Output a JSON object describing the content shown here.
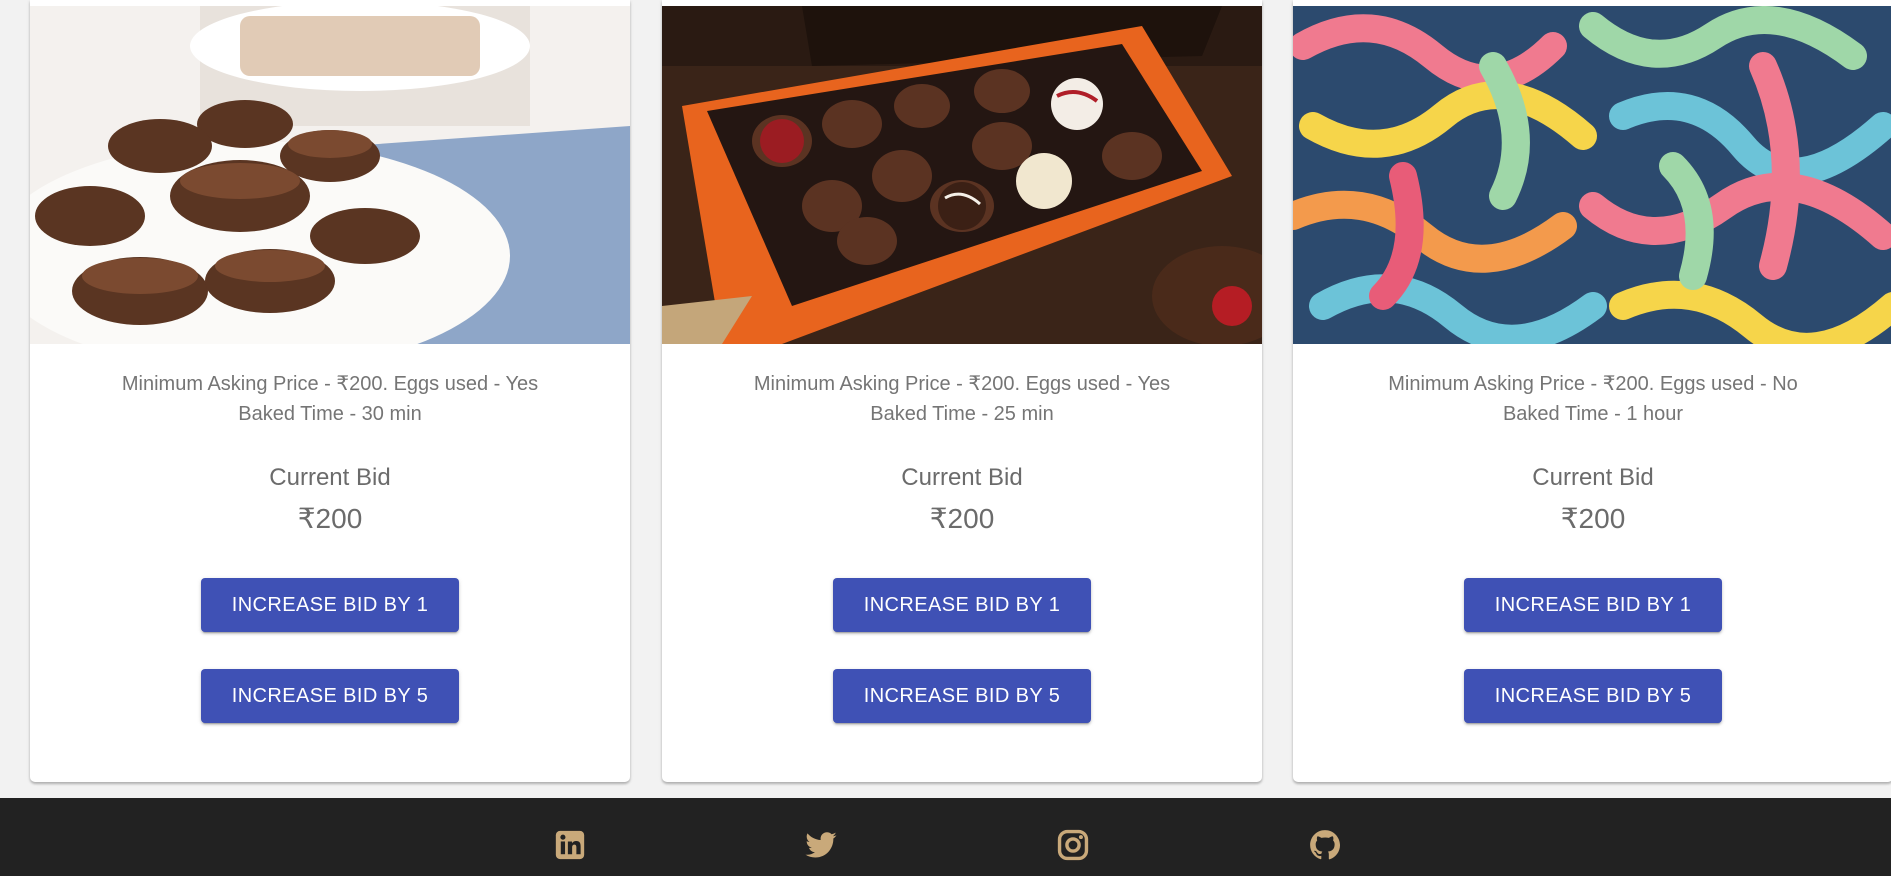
{
  "currency_symbol": "₹",
  "cards": [
    {
      "image": "chocolate-cups-photo",
      "description_line1": "Minimum Asking Price - ₹200. Eggs used - Yes",
      "description_line2": "Baked Time - 30 min",
      "current_bid_label": "Current Bid",
      "current_bid_value": "₹200",
      "increase_by_1_label": "INCREASE BID BY 1",
      "increase_by_5_label": "INCREASE BID BY 5"
    },
    {
      "image": "chocolate-box-photo",
      "description_line1": "Minimum Asking Price - ₹200. Eggs used - Yes",
      "description_line2": "Baked Time - 25 min",
      "current_bid_label": "Current Bid",
      "current_bid_value": "₹200",
      "increase_by_1_label": "INCREASE BID BY 1",
      "increase_by_5_label": "INCREASE BID BY 5"
    },
    {
      "image": "gummy-worms-photo",
      "description_line1": "Minimum Asking Price - ₹200. Eggs used - No",
      "description_line2": "Baked Time - 1 hour",
      "current_bid_label": "Current Bid",
      "current_bid_value": "₹200",
      "increase_by_1_label": "INCREASE BID BY 1",
      "increase_by_5_label": "INCREASE BID BY 5"
    }
  ],
  "footer": {
    "icons": [
      "linkedin-icon",
      "twitter-icon",
      "instagram-icon",
      "github-icon"
    ],
    "icon_color": "#c9a97a",
    "background": "#222222"
  },
  "colors": {
    "button": "#3f51b5",
    "page_background": "#f2f2f2"
  }
}
